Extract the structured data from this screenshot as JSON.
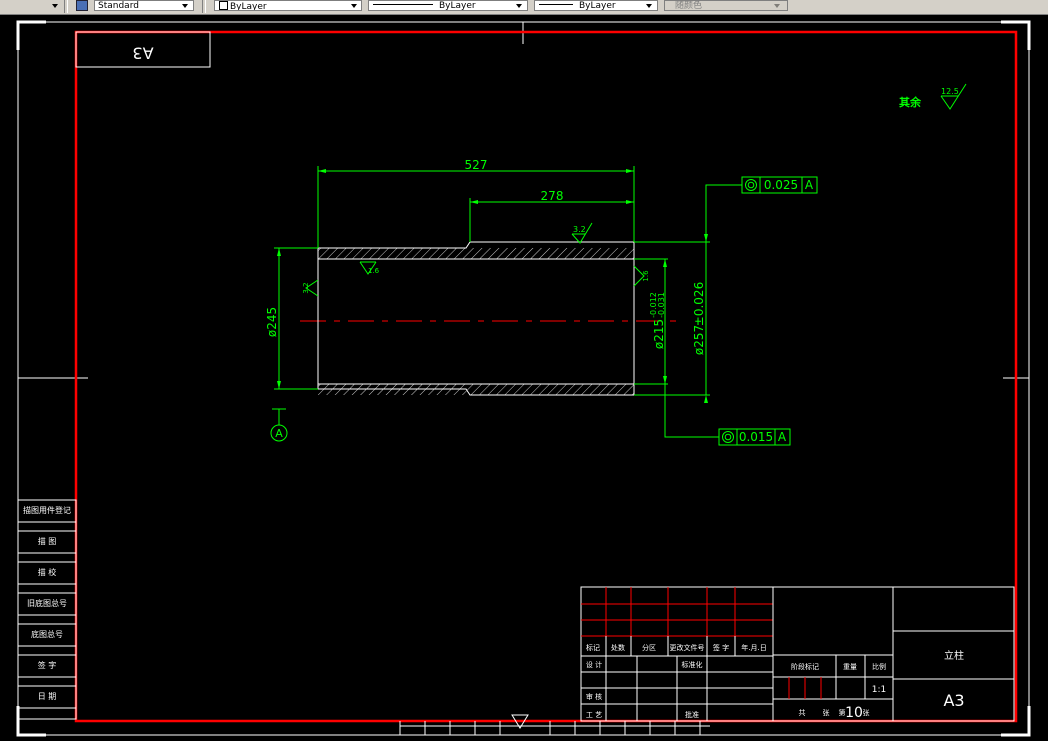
{
  "toolbar": {
    "text_style": "Standard",
    "layer": "ByLayer",
    "linetype": "ByLayer",
    "lineweight": "ByLayer",
    "plot_style": "随颜色"
  },
  "drawing": {
    "sheet_label_mirrored": "A3",
    "roughness_note": "其余",
    "roughness_default": "12.5",
    "dims": {
      "overall_length": "527",
      "step_length": "278",
      "inner_dia": "ø245",
      "bore_dia": "ø215",
      "bore_tol_upper": "-0.012",
      "bore_tol_lower": "-0.031",
      "outer_dia": "ø257",
      "outer_tol": "±0.026"
    },
    "roughness_marks": [
      "3.2",
      "1.6",
      "3.2",
      "1.6"
    ],
    "gdt_top": {
      "symbol": "◎",
      "value": "0.025",
      "datum": "A"
    },
    "gdt_bottom": {
      "symbol": "◎",
      "value": "0.015",
      "datum": "A"
    },
    "datum_label": "A"
  },
  "left_strip": {
    "rows": [
      "描图用件登记",
      "描 图",
      "描 校",
      "旧底图总号",
      "底图总号",
      "签 字",
      "日 期"
    ]
  },
  "title_block": {
    "header_labels": [
      "标记",
      "处数",
      "分区",
      "更改文件号",
      "签 字",
      "年.月.日"
    ],
    "row_design": "设 计",
    "row_std": "标准化",
    "row_review": "审 核",
    "row_process": "工 艺",
    "row_approve": "批准",
    "stage_mark": "阶段标记",
    "weight": "重量",
    "scale": "比例",
    "scale_value": "1:1",
    "sheets_total": "共",
    "sheets_unit": "张",
    "sheet_no": "第",
    "sheet_value": "10",
    "sheet_unit": "张",
    "part_name": "立柱",
    "sheet_size": "A3"
  },
  "colors": {
    "frame": "#ff0000",
    "geometry": "#00ff00",
    "lines": "#ffffff",
    "background": "#000000"
  }
}
